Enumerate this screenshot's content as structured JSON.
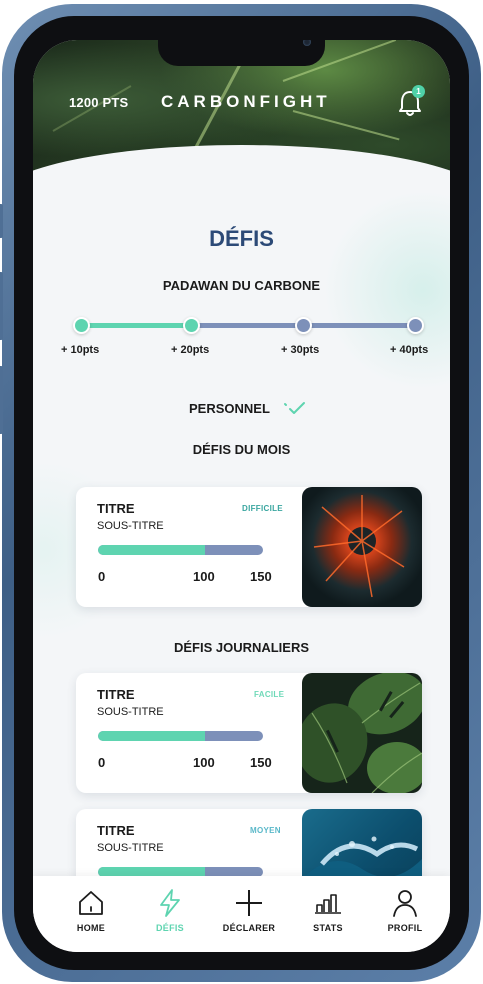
{
  "app": {
    "brand": "CARBONFIGHT",
    "points": "1200 PTS",
    "notification_count": "1"
  },
  "page": {
    "title": "DÉFIS"
  },
  "level": {
    "title": "PADAWAN DU CARBONE",
    "steps": [
      {
        "label": "+ 10pts",
        "reached": true
      },
      {
        "label": "+ 20pts",
        "reached": true
      },
      {
        "label": "+ 30pts",
        "reached": false
      },
      {
        "label": "+ 40pts",
        "reached": false
      }
    ]
  },
  "personal": {
    "label": "PERSONNEL"
  },
  "sections": {
    "monthly": "DÉFIS DU MOIS",
    "daily": "DÉFIS JOURNALIERS"
  },
  "cards": [
    {
      "title": "TITRE",
      "subtitle": "SOUS-TITRE",
      "difficulty": "DIFFICILE",
      "difficulty_color": "#3aa6a0",
      "progress": 0.65,
      "min": "0",
      "mid": "100",
      "max": "150",
      "image": "fire-image"
    },
    {
      "title": "TITRE",
      "subtitle": "SOUS-TITRE",
      "difficulty": "FACILE",
      "difficulty_color": "#6fd9b8",
      "progress": 0.65,
      "min": "0",
      "mid": "100",
      "max": "150",
      "image": "monstera-image"
    },
    {
      "title": "TITRE",
      "subtitle": "SOUS-TITRE",
      "difficulty": "MOYEN",
      "difficulty_color": "#5ab8c9",
      "progress": 0.65,
      "image": "ocean-image"
    }
  ],
  "nav": [
    {
      "label": "HOME",
      "icon": "home-icon",
      "active": false
    },
    {
      "label": "DÉFIS",
      "icon": "lightning-icon",
      "active": true
    },
    {
      "label": "DÉCLARER",
      "icon": "plus-icon",
      "active": false
    },
    {
      "label": "STATS",
      "icon": "bar-chart-icon",
      "active": false
    },
    {
      "label": "PROFIL",
      "icon": "user-icon",
      "active": false
    }
  ],
  "colors": {
    "accent": "#5ed4b0",
    "track_inactive": "#7d90b9",
    "title": "#2c4a77"
  }
}
